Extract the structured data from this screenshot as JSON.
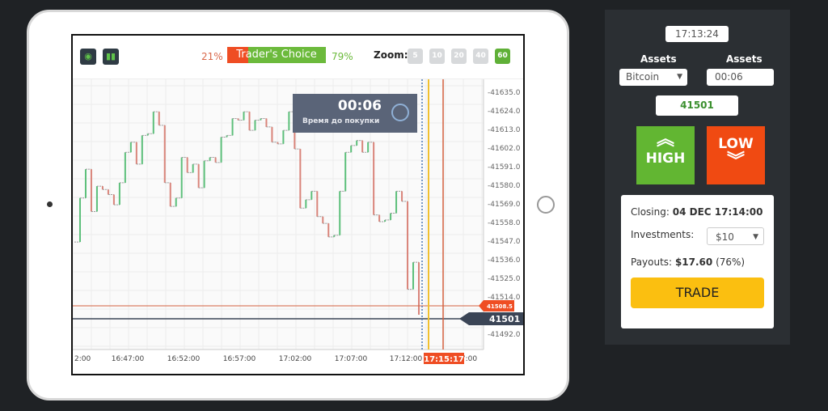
{
  "toolbar": {
    "icons": [
      "target-icon",
      "bar-chart-icon"
    ],
    "sell_pct": "21%",
    "label": "Trader's Choice",
    "buy_pct": "79%",
    "sell_share": 21,
    "zoom_label": "Zoom:",
    "zoom_options": [
      "5",
      "10",
      "20",
      "40",
      "60"
    ],
    "zoom_selected": "60"
  },
  "timer": {
    "value": "00:06",
    "caption": "Время до покупки"
  },
  "chart": {
    "y_ticks": [
      "41635.0",
      "41624.0",
      "41613.0",
      "41602.0",
      "41591.0",
      "41580.0",
      "41569.0",
      "41558.0",
      "41547.0",
      "41536.0",
      "41525.0",
      "41514.0",
      "41492.0"
    ],
    "x_ticks": [
      "2:00",
      "16:47:00",
      "16:52:00",
      "16:57:00",
      "17:02:00",
      "17:07:00",
      "17:12:00",
      "7:00"
    ],
    "strike_label": "41508.5",
    "current_label": "41501",
    "expiry_label": "17:15:17",
    "prices": [
      41546,
      41572,
      41589,
      41564,
      41579,
      41577,
      41574,
      41568,
      41581,
      41599,
      41605,
      41592,
      41609,
      41610,
      41623,
      41615,
      41581,
      41567,
      41572,
      41596,
      41587,
      41592,
      41578,
      41594,
      41596,
      41593,
      41608,
      41609,
      41619,
      41618,
      41623,
      41612,
      41618,
      41619,
      41614,
      41605,
      41604,
      41612,
      41623,
      41601,
      41566,
      41571,
      41576,
      41561,
      41557,
      41549,
      41550,
      41576,
      41599,
      41603,
      41606,
      41599,
      41605,
      41562,
      41558,
      41559,
      41563,
      41576,
      41570,
      41518,
      41534,
      41503
    ],
    "colors": {
      "up": "#5cbf7a",
      "down": "#d9847a",
      "strike": "#d3603e",
      "current": "#3b4556",
      "expiry": "#f0c030",
      "deadline": "#4a78b8"
    }
  },
  "panel": {
    "time": "17:13:24",
    "assets_label_1": "Assets",
    "assets_label_2": "Assets",
    "asset": "Bitcoin",
    "countdown": "00:06",
    "price": "41501",
    "high": "HIGH",
    "low": "LOW",
    "closing_label": "Closing:",
    "closing_value": "04 DEC 17:14:00",
    "investments_label": "Investments:",
    "investment": "$10",
    "payouts_label": "Payouts:",
    "payout_value": "$17.60",
    "payout_pct": "(76%)",
    "trade": "TRADE"
  }
}
